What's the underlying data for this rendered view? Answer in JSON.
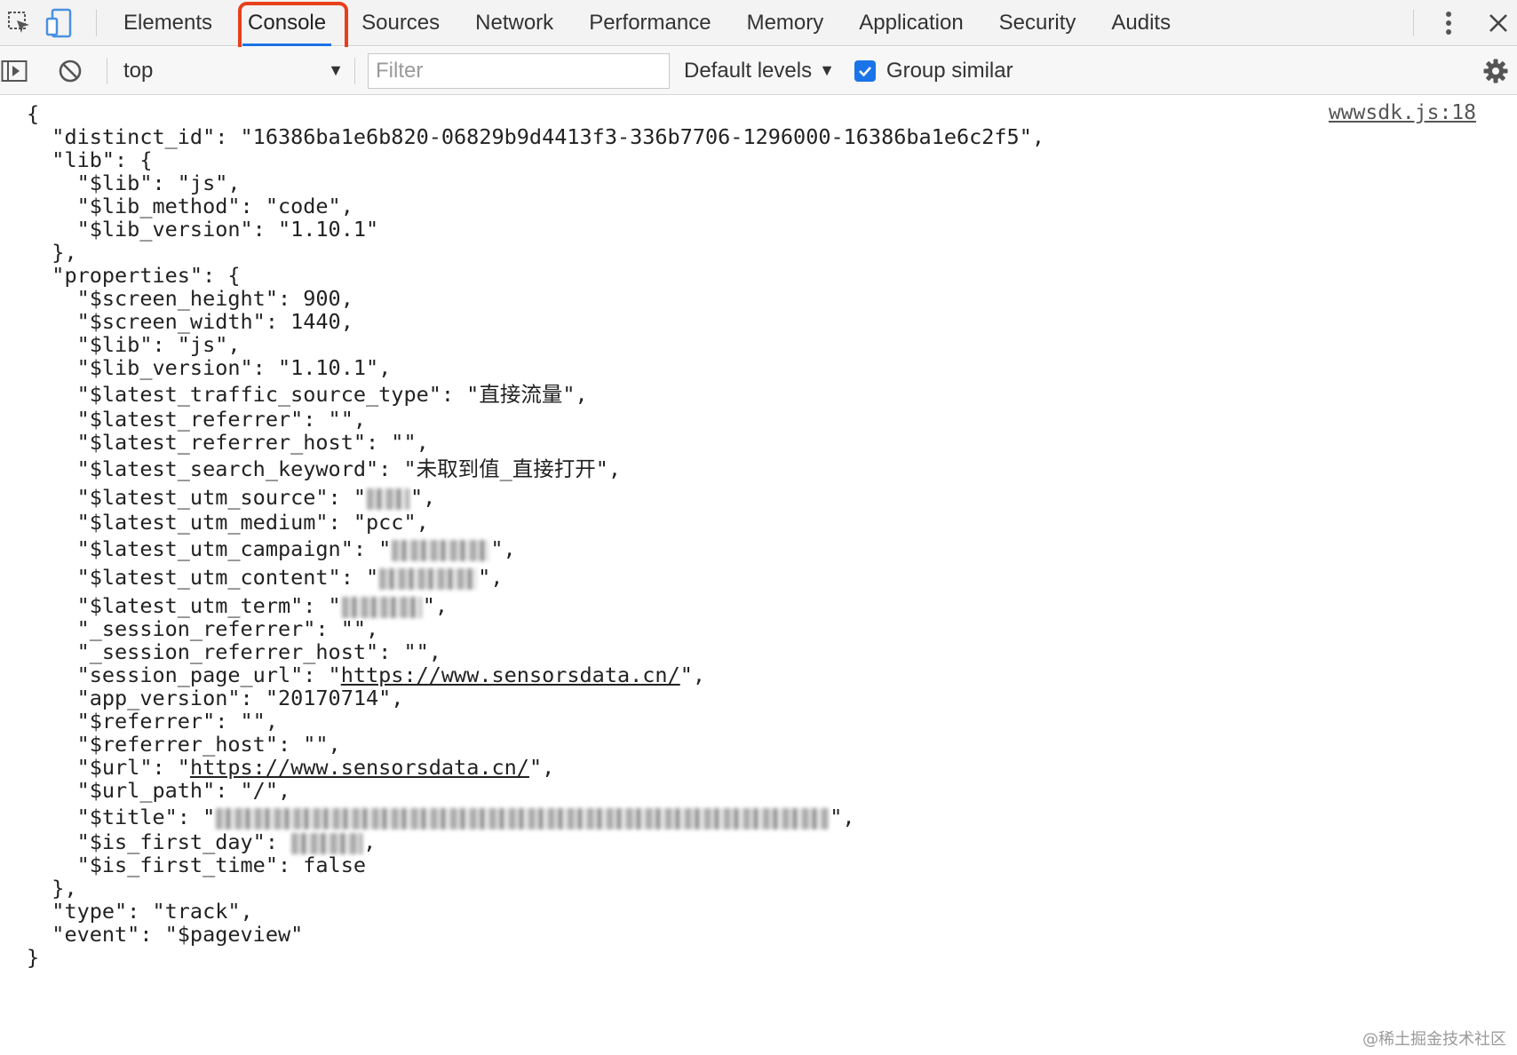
{
  "tabbar": {
    "tabs": [
      {
        "label": "Elements"
      },
      {
        "label": "Console"
      },
      {
        "label": "Sources"
      },
      {
        "label": "Network"
      },
      {
        "label": "Performance"
      },
      {
        "label": "Memory"
      },
      {
        "label": "Application"
      },
      {
        "label": "Security"
      },
      {
        "label": "Audits"
      }
    ],
    "active_tab": "Console",
    "highlight_color": "#e8401c",
    "icons": [
      "inspect-element-icon",
      "device-toolbar-icon",
      "more-options-icon",
      "close-icon"
    ]
  },
  "toolbar": {
    "context": "top",
    "filter_placeholder": "Filter",
    "filter_value": "",
    "levels_label": "Default levels",
    "group_similar_label": "Group similar",
    "group_similar_checked": true,
    "accent_color": "#1a73e8",
    "icons": [
      "sidebar-toggle-icon",
      "clear-console-icon",
      "dropdown-caret-icon",
      "settings-gear-icon"
    ]
  },
  "console": {
    "source_link": "wwwsdk.js:18",
    "lines": [
      {
        "text": "{"
      },
      {
        "text": "  \"distinct_id\": \"16386ba1e6b820-06829b9d4413f3-336b7706-1296000-16386ba1e6c2f5\","
      },
      {
        "text": "  \"lib\": {"
      },
      {
        "text": "    \"$lib\": \"js\","
      },
      {
        "text": "    \"$lib_method\": \"code\","
      },
      {
        "text": "    \"$lib_version\": \"1.10.1\""
      },
      {
        "text": "  },"
      },
      {
        "text": "  \"properties\": {"
      },
      {
        "text": "    \"$screen_height\": 900,"
      },
      {
        "text": "    \"$screen_width\": 1440,"
      },
      {
        "text": "    \"$lib\": \"js\","
      },
      {
        "text": "    \"$lib_version\": \"1.10.1\","
      },
      {
        "text": "    \"$latest_traffic_source_type\": \"直接流量\","
      },
      {
        "text": "    \"$latest_referrer\": \"\","
      },
      {
        "text": "    \"$latest_referrer_host\": \"\","
      },
      {
        "text": "    \"$latest_search_keyword\": \"未取到值_直接打开\","
      },
      {
        "prefix": "    \"$latest_utm_source\": \"",
        "suffix": "\",",
        "blur_w": 48
      },
      {
        "text": "    \"$latest_utm_medium\": \"pcc\","
      },
      {
        "prefix": "    \"$latest_utm_campaign\": \"",
        "suffix": "\",",
        "blur_w": 110
      },
      {
        "prefix": "    \"$latest_utm_content\": \"",
        "suffix": "\",",
        "blur_w": 110
      },
      {
        "prefix": "    \"$latest_utm_term\": \"",
        "suffix": "\",",
        "blur_w": 90
      },
      {
        "text": "    \"_session_referrer\": \"\","
      },
      {
        "text": "    \"_session_referrer_host\": \"\","
      },
      {
        "prefix": "    \"session_page_url\": \"",
        "link": "https://www.sensorsdata.cn/",
        "suffix": "\","
      },
      {
        "text": "    \"app_version\": \"20170714\","
      },
      {
        "text": "    \"$referrer\": \"\","
      },
      {
        "text": "    \"$referrer_host\": \"\","
      },
      {
        "prefix": "    \"$url\": \"",
        "link": "https://www.sensorsdata.cn/",
        "suffix": "\","
      },
      {
        "text": "    \"$url_path\": \"/\","
      },
      {
        "prefix": "    \"$title\": \"",
        "suffix": "\",",
        "blur_w": 690
      },
      {
        "prefix": "    \"$is_first_day\": ",
        "suffix": ",",
        "blur_w": 80
      },
      {
        "text": "    \"$is_first_time\": false"
      },
      {
        "text": "  },"
      },
      {
        "text": "  \"type\": \"track\","
      },
      {
        "text": "  \"event\": \"$pageview\""
      },
      {
        "text": "}"
      }
    ]
  },
  "watermark": "@稀土掘金技术社区"
}
